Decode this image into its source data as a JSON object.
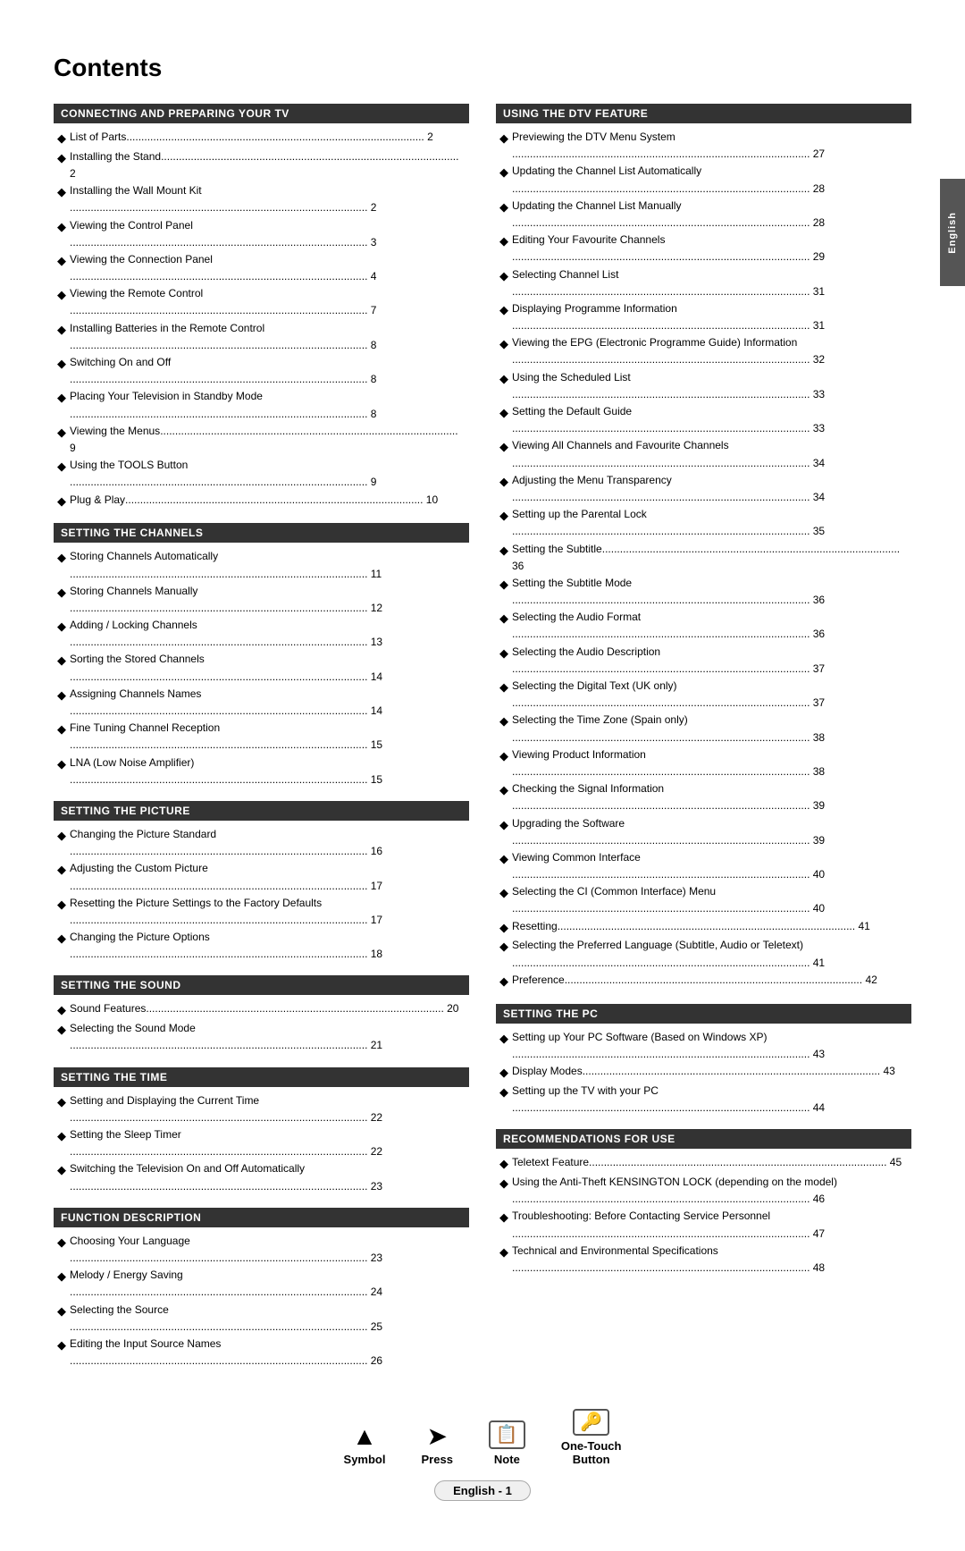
{
  "page": {
    "title": "Contents",
    "side_tab": "English",
    "footer": {
      "symbol_label": "Symbol",
      "press_label": "Press",
      "note_label": "Note",
      "one_touch_label": "One-Touch\nButton"
    },
    "page_number": "English - 1"
  },
  "left_column": {
    "sections": [
      {
        "id": "connecting",
        "header": "CONNECTING AND PREPARING YOUR TV",
        "items": [
          {
            "text": "List of Parts",
            "page": "2"
          },
          {
            "text": "Installing the Stand",
            "page": "2"
          },
          {
            "text": "Installing the Wall Mount Kit",
            "page": "2"
          },
          {
            "text": "Viewing the Control Panel",
            "page": "3"
          },
          {
            "text": "Viewing the Connection Panel",
            "page": "4"
          },
          {
            "text": "Viewing the Remote Control",
            "page": "7"
          },
          {
            "text": "Installing Batteries in the Remote Control",
            "page": "8"
          },
          {
            "text": "Switching On and Off",
            "page": "8"
          },
          {
            "text": "Placing Your Television in Standby Mode",
            "page": "8"
          },
          {
            "text": "Viewing the Menus",
            "page": "9"
          },
          {
            "text": "Using the TOOLS Button",
            "page": "9"
          },
          {
            "text": "Plug & Play",
            "page": "10"
          }
        ]
      },
      {
        "id": "channels",
        "header": "SETTING THE CHANNELS",
        "items": [
          {
            "text": "Storing Channels Automatically",
            "page": "11"
          },
          {
            "text": "Storing Channels Manually",
            "page": "12"
          },
          {
            "text": "Adding / Locking Channels",
            "page": "13"
          },
          {
            "text": "Sorting the Stored Channels",
            "page": "14"
          },
          {
            "text": "Assigning Channels Names",
            "page": "14"
          },
          {
            "text": "Fine Tuning Channel Reception",
            "page": "15"
          },
          {
            "text": "LNA (Low Noise Amplifier)",
            "page": "15"
          }
        ]
      },
      {
        "id": "picture",
        "header": "SETTING THE PICTURE",
        "items": [
          {
            "text": "Changing the Picture Standard",
            "page": "16"
          },
          {
            "text": "Adjusting the Custom Picture",
            "page": "17"
          },
          {
            "text": "Resetting the Picture Settings to the Factory Defaults",
            "page": "17"
          },
          {
            "text": "Changing the Picture Options",
            "page": "18"
          }
        ]
      },
      {
        "id": "sound",
        "header": "SETTING THE SOUND",
        "items": [
          {
            "text": "Sound Features",
            "page": "20"
          },
          {
            "text": "Selecting the Sound Mode",
            "page": "21"
          }
        ]
      },
      {
        "id": "time",
        "header": "SETTING THE TIME",
        "items": [
          {
            "text": "Setting and Displaying the Current Time",
            "page": "22"
          },
          {
            "text": "Setting the Sleep Timer",
            "page": "22"
          },
          {
            "text": "Switching the Television On and Off Automatically",
            "page": "23"
          }
        ]
      },
      {
        "id": "function",
        "header": "FUNCTION DESCRIPTION",
        "items": [
          {
            "text": "Choosing Your Language",
            "page": "23"
          },
          {
            "text": "Melody / Energy Saving",
            "page": "24"
          },
          {
            "text": "Selecting the Source",
            "page": "25"
          },
          {
            "text": "Editing the Input Source Names",
            "page": "26"
          }
        ]
      }
    ]
  },
  "right_column": {
    "sections": [
      {
        "id": "dtv",
        "header": "USING THE DTV FEATURE",
        "items": [
          {
            "text": "Previewing the DTV Menu System",
            "page": "27"
          },
          {
            "text": "Updating the Channel List Automatically",
            "page": "28"
          },
          {
            "text": "Updating the Channel List Manually",
            "page": "28"
          },
          {
            "text": "Editing Your Favourite Channels",
            "page": "29"
          },
          {
            "text": "Selecting Channel List",
            "page": "31"
          },
          {
            "text": "Displaying Programme Information",
            "page": "31"
          },
          {
            "text": "Viewing the EPG (Electronic Programme Guide) Information",
            "page": "32"
          },
          {
            "text": "Using the Scheduled List",
            "page": "33"
          },
          {
            "text": "Setting the Default Guide",
            "page": "33"
          },
          {
            "text": "Viewing All Channels and Favourite Channels",
            "page": "34"
          },
          {
            "text": "Adjusting the Menu Transparency",
            "page": "34"
          },
          {
            "text": "Setting up the Parental Lock",
            "page": "35"
          },
          {
            "text": "Setting the Subtitle",
            "page": "36"
          },
          {
            "text": "Setting the Subtitle Mode",
            "page": "36"
          },
          {
            "text": "Selecting the Audio Format",
            "page": "36"
          },
          {
            "text": "Selecting the Audio Description",
            "page": "37"
          },
          {
            "text": "Selecting the Digital Text (UK only)",
            "page": "37"
          },
          {
            "text": "Selecting the Time Zone (Spain only)",
            "page": "38"
          },
          {
            "text": "Viewing Product Information",
            "page": "38"
          },
          {
            "text": "Checking the Signal Information",
            "page": "39"
          },
          {
            "text": "Upgrading the Software",
            "page": "39"
          },
          {
            "text": "Viewing Common Interface",
            "page": "40"
          },
          {
            "text": "Selecting the CI (Common Interface) Menu",
            "page": "40"
          },
          {
            "text": "Resetting",
            "page": "41"
          },
          {
            "text": "Selecting the Preferred Language (Subtitle, Audio or Teletext)",
            "page": "41"
          },
          {
            "text": "Preference",
            "page": "42"
          }
        ]
      },
      {
        "id": "pc",
        "header": "SETTING THE PC",
        "items": [
          {
            "text": "Setting up Your PC Software (Based on Windows XP)",
            "page": "43"
          },
          {
            "text": "Display Modes",
            "page": "43"
          },
          {
            "text": "Setting up the TV with your PC",
            "page": "44"
          }
        ]
      },
      {
        "id": "recommendations",
        "header": "RECOMMENDATIONS FOR USE",
        "items": [
          {
            "text": "Teletext Feature",
            "page": "45"
          },
          {
            "text": "Using the Anti-Theft KENSINGTON LOCK (depending on the model)",
            "page": "46"
          },
          {
            "text": "Troubleshooting: Before Contacting Service Personnel",
            "page": "47"
          },
          {
            "text": "Technical and Environmental Specifications",
            "page": "48"
          }
        ]
      }
    ]
  }
}
